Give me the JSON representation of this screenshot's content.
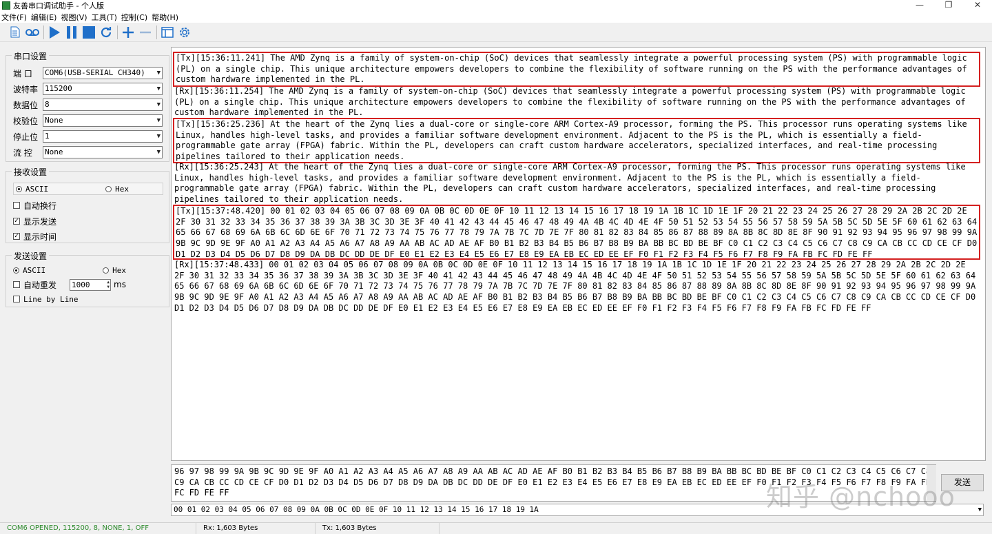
{
  "window": {
    "title": "友善串口调试助手 - 个人版",
    "minimize": "—",
    "maximize": "❐",
    "close": "✕"
  },
  "menu": [
    "文件(F)",
    "编辑(E)",
    "视图(V)",
    "工具(T)",
    "控制(C)",
    "帮助(H)"
  ],
  "toolbar": {
    "icons": [
      "document-icon",
      "cassette-icon",
      "play-icon",
      "pause-icon",
      "stop-icon",
      "refresh-icon",
      "plus-icon",
      "minus-icon",
      "window-icon",
      "gear-icon"
    ],
    "accent_color": "#1f6fc9"
  },
  "serial_settings": {
    "title": "串口设置",
    "port_label": "端 口",
    "port_value": "COM6(USB-SERIAL CH340)",
    "baud_label": "波特率",
    "baud_value": "115200",
    "databits_label": "数据位",
    "databits_value": "8",
    "parity_label": "校验位",
    "parity_value": "None",
    "stopbits_label": "停止位",
    "stopbits_value": "1",
    "flow_label": "流 控",
    "flow_value": "None"
  },
  "receive_settings": {
    "title": "接收设置",
    "ascii_label": "ASCII",
    "hex_label": "Hex",
    "autowrap_label": "自动换行",
    "show_send_label": "显示发送",
    "show_time_label": "显示时间",
    "selected_mode": "ASCII"
  },
  "send_settings": {
    "title": "发送设置",
    "ascii_label": "ASCII",
    "hex_label": "Hex",
    "auto_resend_label": "自动重发",
    "interval_value": "1000",
    "interval_unit": "ms",
    "line_by_line_label": "Line by Line",
    "selected_mode": "ASCII"
  },
  "output": {
    "messages": [
      {
        "text": "[Tx][15:36:11.241] The AMD Zynq is a family of system-on-chip (SoC) devices that seamlessly integrate a powerful processing system (PS) with programmable logic (PL) on a single chip. This unique architecture empowers developers to combine the flexibility of software running on the PS with the performance advantages of custom hardware implemented in the PL.",
        "highlight": true
      },
      {
        "text": "[Rx][15:36:11.254] The AMD Zynq is a family of system-on-chip (SoC) devices that seamlessly integrate a powerful processing system (PS) with programmable logic (PL) on a single chip. This unique architecture empowers developers to combine the flexibility of software running on the PS with the performance advantages of custom hardware implemented in the PL.",
        "highlight": false
      },
      {
        "text": "[Tx][15:36:25.236] At the heart of the Zynq lies a dual-core or single-core ARM Cortex-A9 processor, forming the PS. This processor runs operating systems like Linux, handles high-level tasks, and provides a familiar software development environment. Adjacent to the PS is the PL, which is essentially a field-programmable gate array (FPGA) fabric. Within the PL, developers can craft custom hardware accelerators, specialized interfaces, and real-time processing pipelines tailored to their application needs.",
        "highlight": true
      },
      {
        "text": "[Rx][15:36:25.243] At the heart of the Zynq lies a dual-core or single-core ARM Cortex-A9 processor, forming the PS. This processor runs operating systems like Linux, handles high-level tasks, and provides a familiar software development environment. Adjacent to the PS is the PL, which is essentially a field-programmable gate array (FPGA) fabric. Within the PL, developers can craft custom hardware accelerators, specialized interfaces, and real-time processing pipelines tailored to their application needs.",
        "highlight": false
      },
      {
        "text": "[Tx][15:37:48.420] 00 01 02 03 04 05 06 07 08 09 0A 0B 0C 0D 0E 0F 10 11 12 13 14 15 16 17 18 19 1A 1B 1C 1D 1E 1F 20 21 22 23 24 25 26 27 28 29 2A 2B 2C 2D 2E 2F 30 31 32 33 34 35 36 37 38 39 3A 3B 3C 3D 3E 3F 40 41 42 43 44 45 46 47 48 49 4A 4B 4C 4D 4E 4F 50 51 52 53 54 55 56 57 58 59 5A 5B 5C 5D 5E 5F 60 61 62 63 64 65 66 67 68 69 6A 6B 6C 6D 6E 6F 70 71 72 73 74 75 76 77 78 79 7A 7B 7C 7D 7E 7F 80 81 82 83 84 85 86 87 88 89 8A 8B 8C 8D 8E 8F 90 91 92 93 94 95 96 97 98 99 9A 9B 9C 9D 9E 9F A0 A1 A2 A3 A4 A5 A6 A7 A8 A9 AA AB AC AD AE AF B0 B1 B2 B3 B4 B5 B6 B7 B8 B9 BA BB BC BD BE BF C0 C1 C2 C3 C4 C5 C6 C7 C8 C9 CA CB CC CD CE CF D0 D1 D2 D3 D4 D5 D6 D7 D8 D9 DA DB DC DD DE DF E0 E1 E2 E3 E4 E5 E6 E7 E8 E9 EA EB EC ED EE EF F0 F1 F2 F3 F4 F5 F6 F7 F8 F9 FA FB FC FD FE FF",
        "highlight": true
      },
      {
        "text": "[Rx][15:37:48.433] 00 01 02 03 04 05 06 07 08 09 0A 0B 0C 0D 0E 0F 10 11 12 13 14 15 16 17 18 19 1A 1B 1C 1D 1E 1F 20 21 22 23 24 25 26 27 28 29 2A 2B 2C 2D 2E 2F 30 31 32 33 34 35 36 37 38 39 3A 3B 3C 3D 3E 3F 40 41 42 43 44 45 46 47 48 49 4A 4B 4C 4D 4E 4F 50 51 52 53 54 55 56 57 58 59 5A 5B 5C 5D 5E 5F 60 61 62 63 64 65 66 67 68 69 6A 6B 6C 6D 6E 6F 70 71 72 73 74 75 76 77 78 79 7A 7B 7C 7D 7E 7F 80 81 82 83 84 85 86 87 88 89 8A 8B 8C 8D 8E 8F 90 91 92 93 94 95 96 97 98 99 9A 9B 9C 9D 9E 9F A0 A1 A2 A3 A4 A5 A6 A7 A8 A9 AA AB AC AD AE AF B0 B1 B2 B3 B4 B5 B6 B7 B8 B9 BA BB BC BD BE BF C0 C1 C2 C3 C4 C5 C6 C7 C8 C9 CA CB CC CD CE CF D0 D1 D2 D3 D4 D5 D6 D7 D8 D9 DA DB DC DD DE DF E0 E1 E2 E3 E4 E5 E6 E7 E8 E9 EA EB EC ED EE EF F0 F1 F2 F3 F4 F5 F6 F7 F8 F9 FA FB FC FD FE FF",
        "highlight": false
      }
    ],
    "highlight_color": "#d42020"
  },
  "send_area": {
    "text": "96 97 98 99 9A 9B 9C 9D 9E 9F A0 A1 A2 A3 A4 A5 A6 A7 A8 A9 AA AB AC AD AE AF B0 B1 B2 B3 B4 B5 B6 B7 B8 B9 BA BB BC BD BE BF C0 C1 C2 C3 C4 C5 C6 C7 C8 C9 CA CB CC CD CE CF D0 D1 D2 D3 D4 D5 D6 D7 D8 D9 DA DB DC DD DE DF E0 E1 E2 E3 E4 E5 E6 E7 E8 E9 EA EB EC ED EE EF F0 F1 F2 F3 F4 F5 F6 F7 F8 F9 FA FB FC FD FE FF",
    "send_label": "发送"
  },
  "history": {
    "value": "00 01 02 03 04 05 06 07 08 09 0A 0B 0C 0D 0E 0F 10 11 12 13 14 15 16 17 18 19 1A"
  },
  "status": {
    "port_status": "COM6 OPENED, 115200, 8, NONE, 1, OFF",
    "rx": "Rx: 1,603 Bytes",
    "tx": "Tx: 1,603 Bytes",
    "port_status_color": "#2e8b2e"
  },
  "watermark": "知乎 @nchooo"
}
